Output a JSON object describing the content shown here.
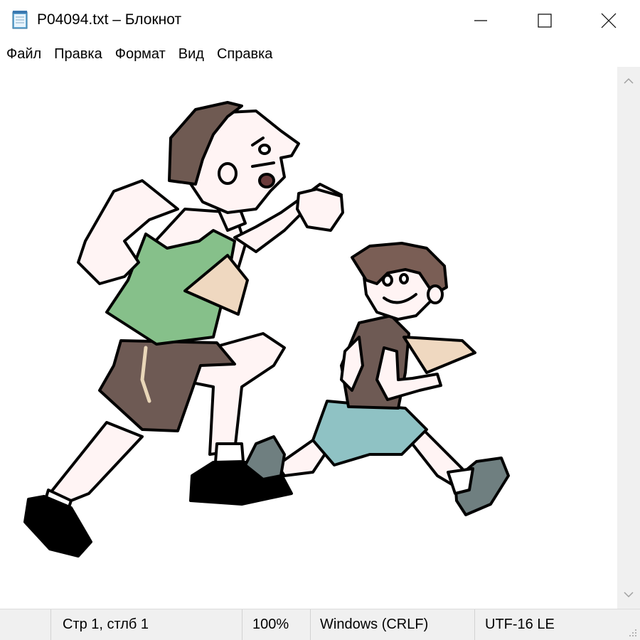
{
  "window": {
    "title": "P04094.txt – Блокнот"
  },
  "menu": {
    "items": [
      "Файл",
      "Правка",
      "Формат",
      "Вид",
      "Справка"
    ]
  },
  "status": {
    "position": "Стр 1, стлб 1",
    "zoom": "100%",
    "line_endings": "Windows (CRLF)",
    "encoding": "UTF-16 LE"
  },
  "icons": {
    "app": "notepad-icon",
    "minimize": "minimize-icon",
    "maximize": "maximize-icon",
    "close": "close-icon",
    "scroll_up": "chevron-up-icon",
    "scroll_down": "chevron-down-icon"
  },
  "colors": {
    "vest": "#86c08a",
    "shorts_man": "#6e5a54",
    "hair_man": "#6f5a52",
    "bib": "#efd8c0",
    "shirt_boy": "#6e5a54",
    "shorts_boy": "#8fc2c4",
    "hair_boy": "#7a5e55",
    "skin": "#fff4f4",
    "shoe": "#000000",
    "shoe_boy": "#6f7f80"
  }
}
